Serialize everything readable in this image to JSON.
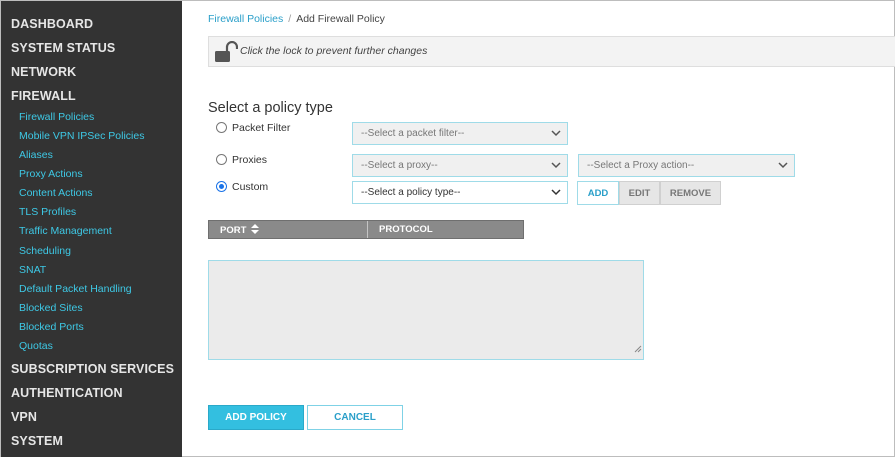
{
  "sidebar": {
    "top_items": [
      {
        "label": "DASHBOARD"
      },
      {
        "label": "SYSTEM STATUS"
      },
      {
        "label": "NETWORK"
      },
      {
        "label": "FIREWALL"
      }
    ],
    "firewall_items": [
      {
        "label": "Firewall Policies"
      },
      {
        "label": "Mobile VPN IPSec Policies"
      },
      {
        "label": "Aliases"
      },
      {
        "label": "Proxy Actions"
      },
      {
        "label": "Content Actions"
      },
      {
        "label": "TLS Profiles"
      },
      {
        "label": "Traffic Management"
      },
      {
        "label": "Scheduling"
      },
      {
        "label": "SNAT"
      },
      {
        "label": "Default Packet Handling"
      },
      {
        "label": "Blocked Sites"
      },
      {
        "label": "Blocked Ports"
      },
      {
        "label": "Quotas"
      }
    ],
    "bottom_items": [
      {
        "label": "SUBSCRIPTION SERVICES"
      },
      {
        "label": "AUTHENTICATION"
      },
      {
        "label": "VPN"
      },
      {
        "label": "SYSTEM"
      }
    ]
  },
  "breadcrumb": {
    "parent": "Firewall Policies",
    "separator": "/",
    "current": "Add Firewall Policy"
  },
  "lockbar": {
    "icon": "unlocked-padlock-icon",
    "message": "Click the lock to prevent further changes"
  },
  "form": {
    "title": "Select a policy type",
    "options": [
      {
        "label": "Packet Filter",
        "checked": false
      },
      {
        "label": "Proxies",
        "checked": false
      },
      {
        "label": "Custom",
        "checked": true
      }
    ],
    "packet_filter_select": "--Select a packet filter--",
    "proxy_select": "--Select a proxy--",
    "proxy_action_select": "--Select a Proxy action--",
    "policy_type_select": "--Select a policy type--",
    "buttons": {
      "add": "ADD",
      "edit": "EDIT",
      "remove": "REMOVE"
    }
  },
  "table": {
    "columns": [
      "PORT",
      "PROTOCOL"
    ],
    "sort_icon": "sort-icon"
  },
  "actions": {
    "add_policy": "ADD POLICY",
    "cancel": "CANCEL"
  },
  "colors": {
    "sidebar_bg": "#333333",
    "sidebar_link": "#3ec9e6",
    "accent": "#33bfe0"
  }
}
